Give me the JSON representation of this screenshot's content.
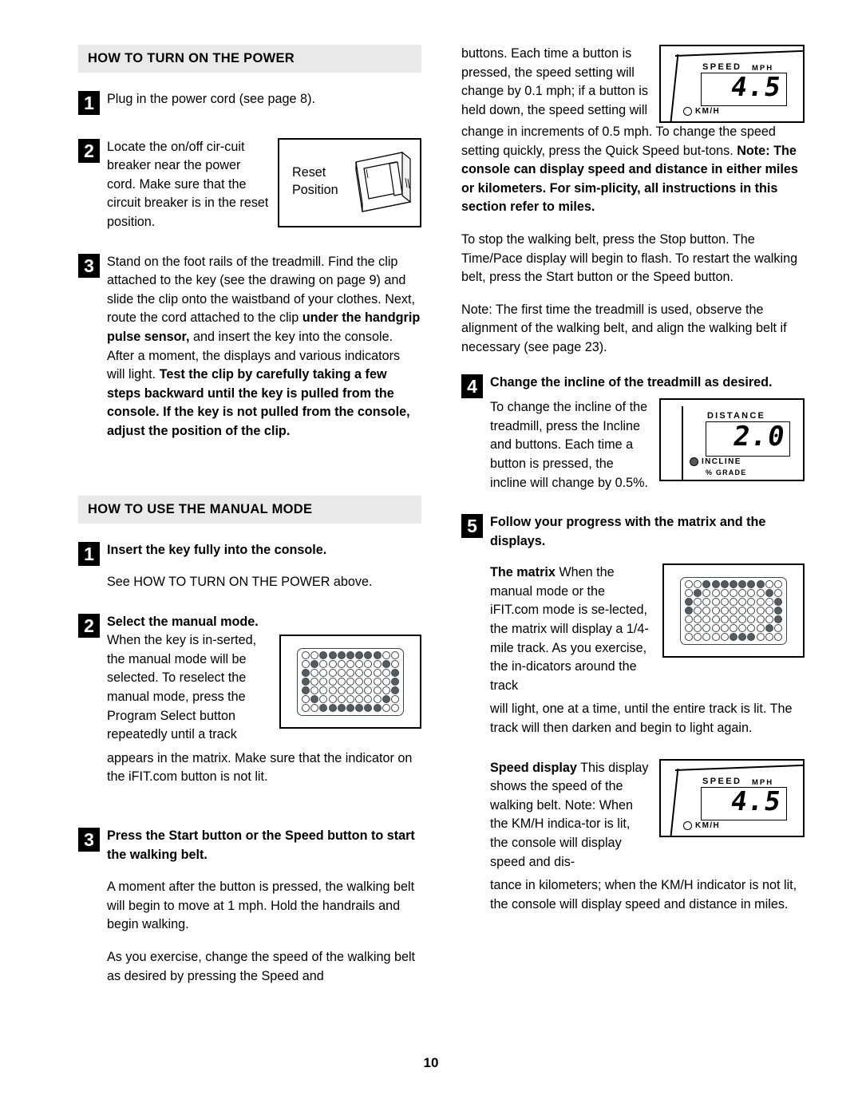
{
  "page": {
    "number": "10"
  },
  "sections": {
    "power": {
      "heading": "HOW TO TURN ON THE POWER",
      "steps": {
        "one": {
          "num": "1",
          "text": "Plug in the power cord (see page 8)."
        },
        "two": {
          "num": "2",
          "text": "Locate the on/off cir-cuit breaker near the power cord. Make sure that the circuit breaker is in the reset position."
        },
        "three": {
          "num": "3",
          "text_a": "Stand on the foot rails of the treadmill. Find the clip attached to the key (see the drawing on page 9) and slide the clip onto the waistband of your clothes. Next, route the cord attached to the clip ",
          "text_b": "under the handgrip pulse sensor,",
          "text_c": " and insert the key into the console. After a moment, the displays and various indicators will light. ",
          "text_d": "Test the clip by carefully taking a few steps backward until the key is pulled from the console. If the key is not pulled from the console, adjust the position of the clip."
        }
      },
      "reset_figure": {
        "label_line1": "Reset",
        "label_line2": "Position"
      }
    },
    "manual": {
      "heading": "HOW TO USE THE MANUAL MODE",
      "steps": {
        "one": {
          "num": "1",
          "title": "Insert the key fully into the console.",
          "body": "See HOW TO TURN ON THE POWER above."
        },
        "two": {
          "num": "2",
          "title": "Select the manual mode.",
          "body_wrap": "When the key is in-serted, the manual mode will be selected. To reselect the manual mode, press the Program Select button repeatedly until a track",
          "body_rest": "appears in the matrix. Make sure that the indicator on the iFIT.com button is not lit."
        },
        "three": {
          "num": "3",
          "title": "Press the Start button or the Speed     button to start the walking belt.",
          "body1": "A moment after the button is pressed, the walking belt will begin to move at 1 mph. Hold the handrails and begin walking.",
          "body2": "As you exercise, change the speed of the walking belt as desired by pressing the Speed     and"
        },
        "four": {
          "num": "4",
          "title": "Change the incline of the treadmill as desired.",
          "body": "To change the incline of the treadmill, press the Incline    and    buttons. Each time a button is pressed, the incline will change by 0.5%."
        },
        "five": {
          "num": "5",
          "title": "Follow your progress with the matrix and the displays.",
          "matrix_bold": "The matrix",
          "matrix_wrap": " When the manual mode or the iFIT.com mode is se-lected, the matrix will display a 1/4-mile track. As you exercise, the in-dicators around the track",
          "matrix_rest": "will light, one at a time, until the entire track is lit. The track will then darken and begin to light again.",
          "speed_bold": "Speed display",
          "speed_wrap": " This display shows the speed of the walking belt. Note: When the KM/H indica-tor is lit, the console will display speed and dis-",
          "speed_rest": "tance in kilometers; when the KM/H indicator is not lit, the console will display speed and distance in miles."
        }
      }
    },
    "continued": {
      "top_wrap": "buttons. Each time a button is pressed, the speed setting will change by 0.1 mph; if a button is held down, the speed setting will",
      "top_rest_a": "change in increments of 0.5 mph. To change the speed setting quickly, press the Quick Speed but-tons. ",
      "top_rest_b": "Note: The console can display speed and distance in either miles or kilometers. For sim-plicity, all instructions in this section refer to miles.",
      "stop_para": "To stop the walking belt, press the Stop button. The Time/Pace display will begin to flash. To restart the walking belt, press the Start button or the Speed     button.",
      "note_para": "Note: The first time the treadmill is used, observe the alignment of the walking belt, and align the walking belt if necessary (see page 23)."
    }
  },
  "figures": {
    "speed_display_top": {
      "title": "SPEED",
      "unit": "MPH",
      "value": "4.5",
      "indicator_label": "KM/H",
      "indicator_lit": false
    },
    "distance_display": {
      "title": "DISTANCE",
      "value": "2.0",
      "indicator_label": "INCLINE",
      "indicator_sublabel": "% GRADE",
      "indicator_lit": true
    },
    "speed_display_bottom": {
      "title": "SPEED",
      "unit": "MPH",
      "value": "4.5",
      "indicator_label": "KM/H",
      "indicator_lit": false
    },
    "matrix_full": {
      "caption": "dot-matrix full track",
      "rows": 7,
      "cols": 11,
      "pattern": [
        [
          0,
          0,
          1,
          1,
          1,
          1,
          1,
          1,
          1,
          0,
          0
        ],
        [
          0,
          1,
          0,
          0,
          0,
          0,
          0,
          0,
          0,
          1,
          0
        ],
        [
          1,
          0,
          0,
          0,
          0,
          0,
          0,
          0,
          0,
          0,
          1
        ],
        [
          1,
          0,
          0,
          0,
          0,
          0,
          0,
          0,
          0,
          0,
          1
        ],
        [
          1,
          0,
          0,
          0,
          0,
          0,
          0,
          0,
          0,
          0,
          1
        ],
        [
          0,
          1,
          0,
          0,
          0,
          0,
          0,
          0,
          0,
          1,
          0
        ],
        [
          0,
          0,
          1,
          1,
          1,
          1,
          1,
          1,
          1,
          0,
          0
        ]
      ]
    },
    "matrix_partial": {
      "caption": "dot-matrix partially lit track",
      "rows": 7,
      "cols": 11,
      "pattern": [
        [
          0,
          0,
          1,
          1,
          1,
          1,
          1,
          1,
          1,
          0,
          0
        ],
        [
          0,
          1,
          0,
          0,
          0,
          0,
          0,
          0,
          0,
          1,
          0
        ],
        [
          1,
          0,
          0,
          0,
          0,
          0,
          0,
          0,
          0,
          0,
          1
        ],
        [
          1,
          0,
          0,
          0,
          0,
          0,
          0,
          0,
          0,
          0,
          1
        ],
        [
          0,
          0,
          0,
          0,
          0,
          0,
          0,
          0,
          0,
          0,
          1
        ],
        [
          0,
          0,
          0,
          0,
          0,
          0,
          0,
          0,
          0,
          1,
          0
        ],
        [
          0,
          0,
          0,
          0,
          0,
          1,
          1,
          1,
          0,
          0,
          0
        ]
      ]
    }
  },
  "colors": {
    "band": "#e9e9e9",
    "dot_lit": "#545c60",
    "dot_border": "#3f4448",
    "text": "#000000"
  }
}
